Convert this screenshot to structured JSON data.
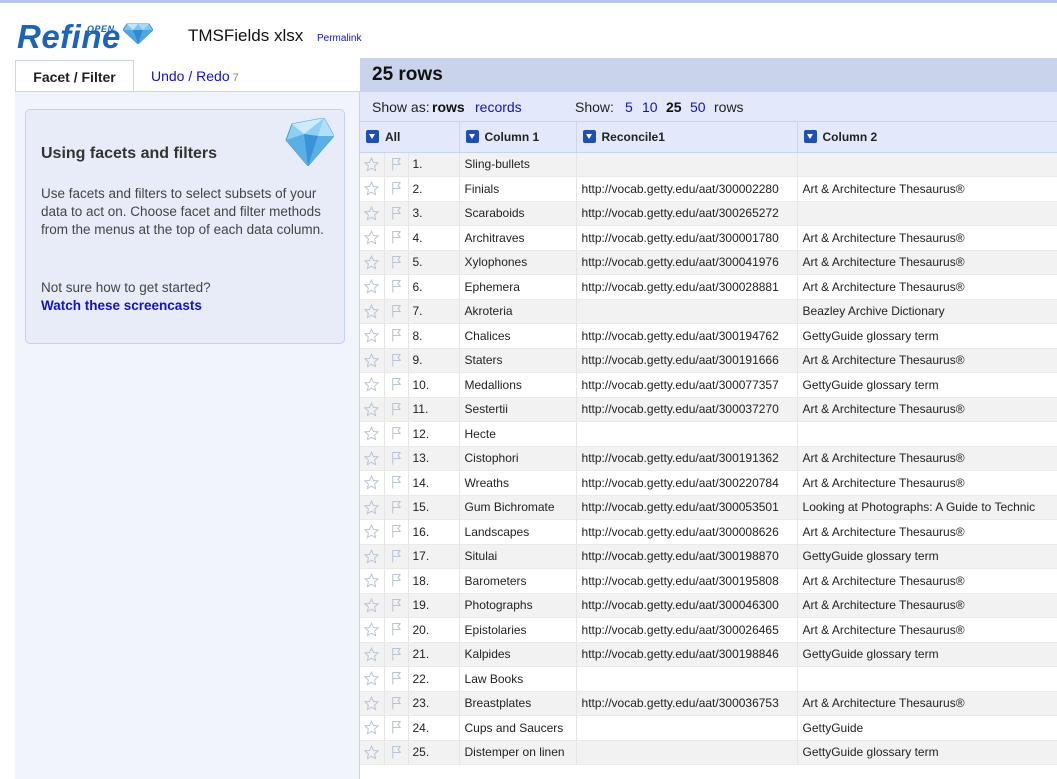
{
  "app": {
    "logo_text": "Refine",
    "logo_superscript": "OPEN",
    "project_name": "TMSFields xlsx",
    "permalink": "Permalink"
  },
  "left_panel": {
    "tabs": [
      {
        "label": "Facet / Filter",
        "active": true
      },
      {
        "label": "Undo / Redo",
        "count": "7",
        "active": false
      }
    ],
    "help": {
      "title": "Using facets and filters",
      "body": "Use facets and filters to select subsets of your data to act on. Choose facet and filter methods from the menus at the top of each data column.",
      "question": "Not sure how to get started?",
      "link": "Watch these screencasts"
    }
  },
  "grid": {
    "row_count": "25 rows",
    "show_as_label": "Show as:",
    "show_as_options": [
      "rows",
      "records"
    ],
    "show_as_selected": "rows",
    "show_label": "Show:",
    "page_sizes": [
      "5",
      "10",
      "25",
      "50"
    ],
    "page_size_selected": "25",
    "page_size_suffix": "rows",
    "columns": [
      "All",
      "Column 1",
      "Reconcile1",
      "Column 2"
    ],
    "rows": [
      {
        "n": "1.",
        "c1": "Sling-bullets",
        "r1": "",
        "c2": ""
      },
      {
        "n": "2.",
        "c1": "Finials",
        "r1": "http://vocab.getty.edu/aat/300002280",
        "c2": "Art & Architecture Thesaurus®"
      },
      {
        "n": "3.",
        "c1": "Scaraboids",
        "r1": "http://vocab.getty.edu/aat/300265272",
        "c2": ""
      },
      {
        "n": "4.",
        "c1": "Architraves",
        "r1": "http://vocab.getty.edu/aat/300001780",
        "c2": "Art & Architecture Thesaurus®"
      },
      {
        "n": "5.",
        "c1": "Xylophones",
        "r1": "http://vocab.getty.edu/aat/300041976",
        "c2": "Art & Architecture Thesaurus®"
      },
      {
        "n": "6.",
        "c1": "Ephemera",
        "r1": "http://vocab.getty.edu/aat/300028881",
        "c2": "Art & Architecture Thesaurus®"
      },
      {
        "n": "7.",
        "c1": "Akroteria",
        "r1": "",
        "c2": "Beazley Archive Dictionary"
      },
      {
        "n": "8.",
        "c1": "Chalices",
        "r1": "http://vocab.getty.edu/aat/300194762",
        "c2": "GettyGuide glossary term"
      },
      {
        "n": "9.",
        "c1": "Staters",
        "r1": "http://vocab.getty.edu/aat/300191666",
        "c2": "Art & Architecture Thesaurus®"
      },
      {
        "n": "10.",
        "c1": "Medallions",
        "r1": "http://vocab.getty.edu/aat/300077357",
        "c2": "GettyGuide glossary term"
      },
      {
        "n": "11.",
        "c1": "Sestertii",
        "r1": "http://vocab.getty.edu/aat/300037270",
        "c2": "Art & Architecture Thesaurus®"
      },
      {
        "n": "12.",
        "c1": "Hecte",
        "r1": "",
        "c2": ""
      },
      {
        "n": "13.",
        "c1": "Cistophori",
        "r1": "http://vocab.getty.edu/aat/300191362",
        "c2": "Art & Architecture Thesaurus®"
      },
      {
        "n": "14.",
        "c1": "Wreaths",
        "r1": "http://vocab.getty.edu/aat/300220784",
        "c2": "Art & Architecture Thesaurus®"
      },
      {
        "n": "15.",
        "c1": "Gum Bichromate",
        "r1": "http://vocab.getty.edu/aat/300053501",
        "c2": "Looking at Photographs: A Guide to Technic"
      },
      {
        "n": "16.",
        "c1": "Landscapes",
        "r1": "http://vocab.getty.edu/aat/300008626",
        "c2": "Art & Architecture Thesaurus®"
      },
      {
        "n": "17.",
        "c1": "Situlai",
        "r1": "http://vocab.getty.edu/aat/300198870",
        "c2": "GettyGuide glossary term"
      },
      {
        "n": "18.",
        "c1": "Barometers",
        "r1": "http://vocab.getty.edu/aat/300195808",
        "c2": "Art & Architecture Thesaurus®"
      },
      {
        "n": "19.",
        "c1": "Photographs",
        "r1": "http://vocab.getty.edu/aat/300046300",
        "c2": "Art & Architecture Thesaurus®"
      },
      {
        "n": "20.",
        "c1": "Epistolaries",
        "r1": "http://vocab.getty.edu/aat/300026465",
        "c2": "Art & Architecture Thesaurus®"
      },
      {
        "n": "21.",
        "c1": "Kalpides",
        "r1": "http://vocab.getty.edu/aat/300198846",
        "c2": "GettyGuide glossary term"
      },
      {
        "n": "22.",
        "c1": "Law Books",
        "r1": "",
        "c2": ""
      },
      {
        "n": "23.",
        "c1": "Breastplates",
        "r1": "http://vocab.getty.edu/aat/300036753",
        "c2": "Art & Architecture Thesaurus®"
      },
      {
        "n": "24.",
        "c1": "Cups and Saucers",
        "r1": "",
        "c2": "GettyGuide"
      },
      {
        "n": "25.",
        "c1": "Distemper on linen",
        "r1": "",
        "c2": "GettyGuide glossary term"
      }
    ]
  },
  "colors": {
    "accent": "#1e50b4",
    "link": "#1111cc",
    "header_band": "#c9d3ec",
    "view_bar": "#e3e9fa",
    "panel_bg": "#f1f4fb"
  },
  "icons": {
    "logo": "diamond-icon",
    "row_star": "star-icon",
    "row_flag": "flag-icon",
    "column_menu": "dropdown-arrow-icon"
  }
}
